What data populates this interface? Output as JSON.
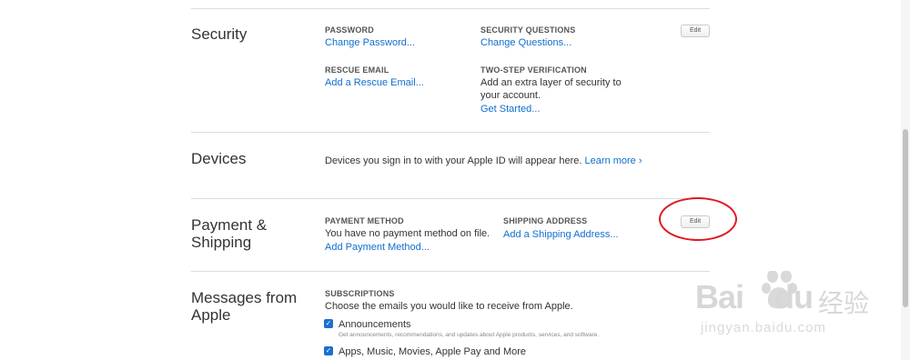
{
  "security": {
    "title": "Security",
    "password_label": "PASSWORD",
    "password_link": "Change Password...",
    "questions_label": "SECURITY QUESTIONS",
    "questions_link": "Change Questions...",
    "rescue_label": "RESCUE EMAIL",
    "rescue_link": "Add a Rescue Email...",
    "twostep_label": "TWO-STEP VERIFICATION",
    "twostep_line1": "Add an extra layer of security to",
    "twostep_line2": "your account.",
    "twostep_link": "Get Started...",
    "edit": "Edit"
  },
  "devices": {
    "title": "Devices",
    "text": "Devices you sign in to with your Apple ID will appear here.",
    "learn_more": "Learn more ›"
  },
  "payment": {
    "title_line1": "Payment &",
    "title_line2": "Shipping",
    "method_label": "PAYMENT METHOD",
    "method_text": "You have no payment method on file.",
    "method_link": "Add Payment Method...",
    "shipping_label": "SHIPPING ADDRESS",
    "shipping_link": "Add a Shipping Address...",
    "edit": "Edit"
  },
  "messages": {
    "title_line1": "Messages from",
    "title_line2": "Apple",
    "subs_label": "SUBSCRIPTIONS",
    "subs_text": "Choose the emails you would like to receive from Apple.",
    "items": [
      {
        "label": "Announcements",
        "desc": "Get announcements, recommendations, and updates about Apple products, services, and software.",
        "checked": true
      },
      {
        "label": "Apps, Music, Movies, Apple Pay and More",
        "desc": "",
        "checked": true
      }
    ]
  },
  "watermark": {
    "brand": "Bai",
    "brand2": "du",
    "cn": "经验",
    "url": "jingyan.baidu.com"
  },
  "colors": {
    "link": "#0f6fcf",
    "checkbox": "#1b6fd1",
    "annotation": "#e01820"
  }
}
